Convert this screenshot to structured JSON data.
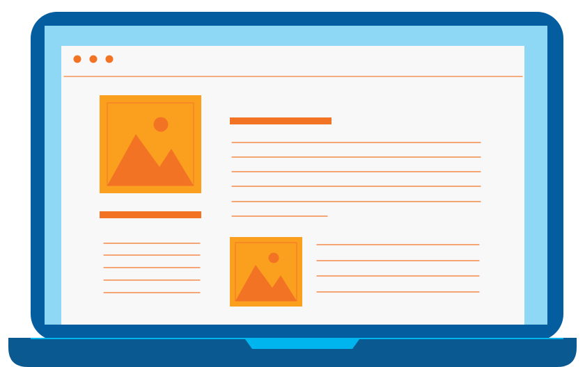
{
  "colors": {
    "laptop_frame": "#035d9f",
    "laptop_base": "#0a5a91",
    "screen_bezel": "#8ed8f6",
    "screen_page": "#f8f8f8",
    "hinge_notch": "#00b4ee",
    "accent_orange": "#f37325",
    "image_fill": "#fba01e",
    "mountain_fill": "#f37325"
  },
  "window_controls": [
    {
      "name": "dot-close"
    },
    {
      "name": "dot-minimize"
    },
    {
      "name": "dot-maximize"
    }
  ],
  "icons": {
    "large_image": "image-placeholder-icon",
    "small_image": "image-placeholder-icon"
  },
  "text_placeholders": {
    "right_paragraph_lines": 6,
    "left_paragraph_lines": 5,
    "bottom_right_lines": 4
  }
}
